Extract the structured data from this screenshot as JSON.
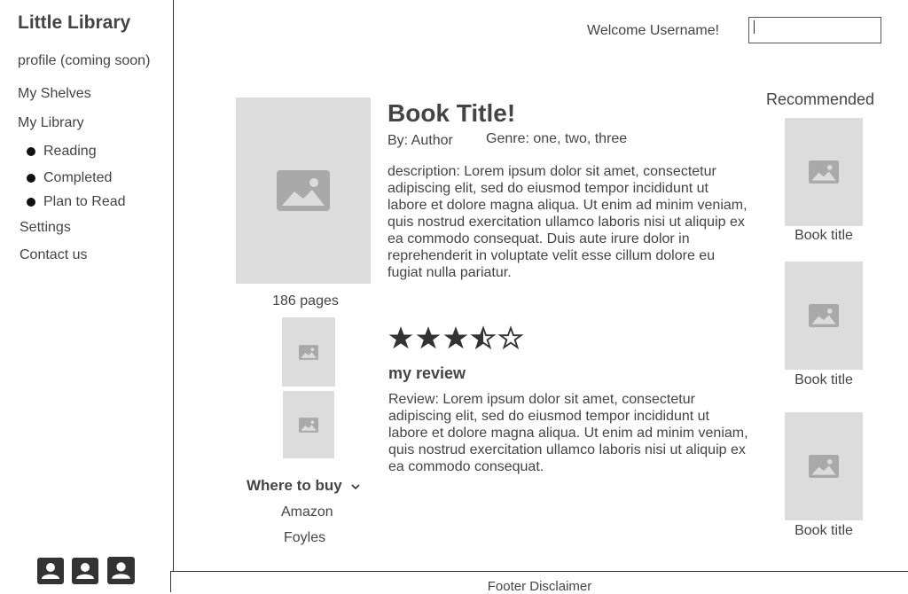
{
  "sidebar": {
    "brand": "Little Library",
    "items": [
      {
        "label": "profile (coming soon)"
      },
      {
        "label": "My Shelves"
      },
      {
        "label": "My Library"
      },
      {
        "label": "Reading"
      },
      {
        "label": "Completed"
      },
      {
        "label": "Plan to Read"
      },
      {
        "label": "Settings"
      },
      {
        "label": "Contact us"
      }
    ],
    "social_icons": [
      "contact-card-icon",
      "contact-card-icon",
      "contact-card-icon"
    ]
  },
  "header": {
    "welcome": "Welcome Username!",
    "search_value": ""
  },
  "book": {
    "title": "Book Title!",
    "author": "By: Author",
    "genre": "Genre: one, two, three",
    "description": "description: Lorem ipsum dolor sit amet, consectetur adipiscing elit, sed do eiusmod tempor incididunt ut labore et dolore magna aliqua. Ut enim ad minim veniam, quis nostrud exercitation ullamco laboris nisi ut aliquip ex ea commodo consequat. Duis aute irure dolor in reprehenderit in voluptate velit esse cillum dolore eu fugiat nulla pariatur.",
    "pages": "186 pages",
    "rating": 3.5,
    "rating_max": 5
  },
  "where_to_buy": {
    "label": "Where to buy",
    "stores": [
      "Amazon",
      "Foyles"
    ]
  },
  "review": {
    "heading": "my review",
    "text": "Review: Lorem ipsum dolor sit amet, consectetur adipiscing elit, sed do eiusmod tempor incididunt ut labore et dolore magna aliqua. Ut enim ad minim veniam, quis nostrud exercitation ullamco laboris nisi ut aliquip ex ea commodo consequat."
  },
  "recommended": {
    "heading": "Recommended",
    "items": [
      {
        "title": "Book title"
      },
      {
        "title": "Book title"
      },
      {
        "title": "Book title"
      }
    ]
  },
  "footer": {
    "text": "Footer Disclaimer"
  },
  "colors": {
    "placeholder_bg": "#dcdcdc",
    "placeholder_icon": "#a9a9a9",
    "text": "#444444"
  }
}
